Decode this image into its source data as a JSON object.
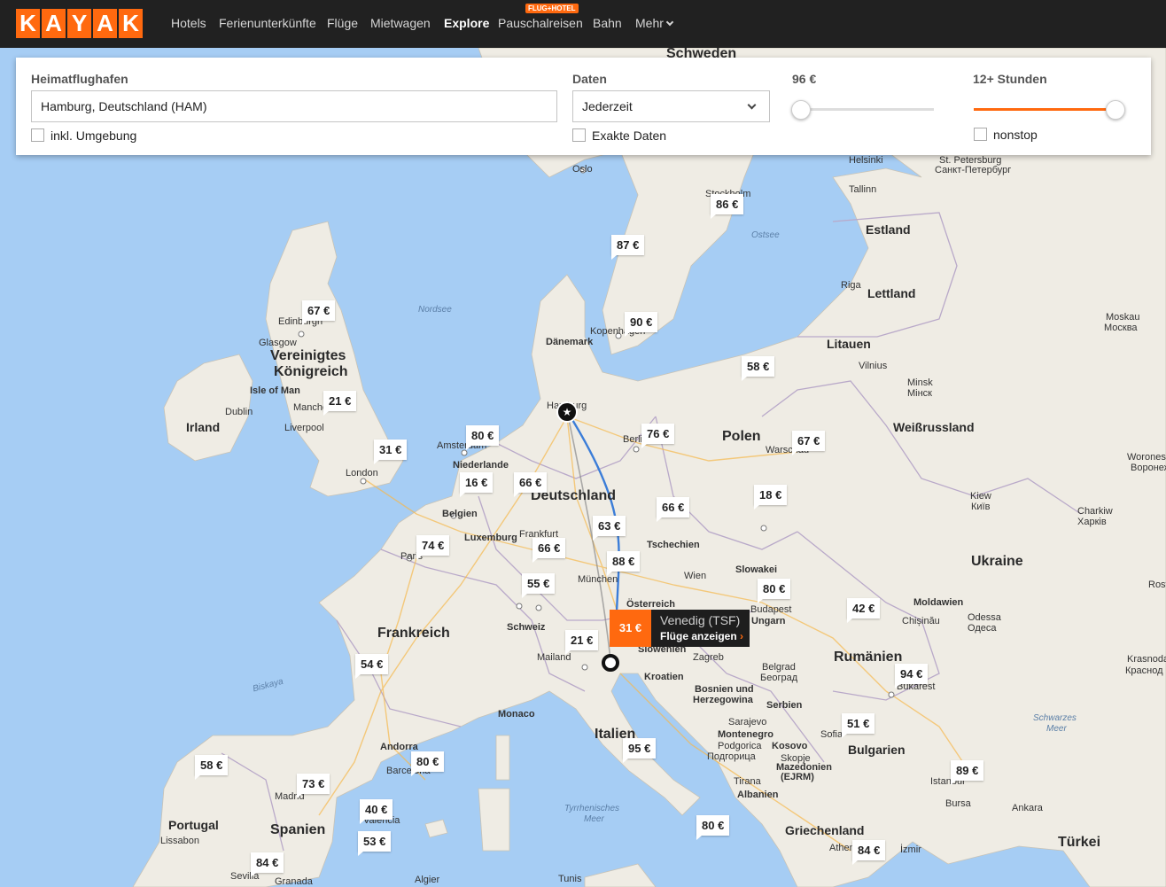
{
  "nav": {
    "logo_letters": [
      "K",
      "A",
      "Y",
      "A",
      "K"
    ],
    "items": [
      "Hotels",
      "Ferienunterkünfte",
      "Flüge",
      "Mietwagen",
      "Explore",
      "Pauschalreisen",
      "Bahn",
      "Mehr"
    ],
    "active": "Explore",
    "badge": "FLUG+HOTEL"
  },
  "search": {
    "home_label": "Heimatflughafen",
    "home_value": "Hamburg, Deutschland (HAM)",
    "nearby_label": "inkl. Umgebung",
    "dates_label": "Daten",
    "dates_value": "Jederzeit",
    "exact_dates_label": "Exakte Daten",
    "price_label": "96 €",
    "price_fraction": 0.0,
    "duration_label": "12+ Stunden",
    "duration_fraction": 1.0,
    "nonstop_label": "nonstop"
  },
  "popup": {
    "price": "31 €",
    "destination": "Venedig (TSF)",
    "link": "Flüge anzeigen",
    "link_arrow": "›"
  },
  "origin_marker_icon": "★",
  "prices": [
    "86 €",
    "87 €",
    "90 €",
    "67 €",
    "58 €",
    "21 €",
    "80 €",
    "76 €",
    "67 €",
    "31 €",
    "16 €",
    "66 €",
    "18 €",
    "63 €",
    "66 €",
    "74 €",
    "66 €",
    "88 €",
    "55 €",
    "80 €",
    "42 €",
    "21 €",
    "54 €",
    "94 €",
    "51 €",
    "58 €",
    "80 €",
    "95 €",
    "73 €",
    "89 €",
    "40 €",
    "53 €",
    "80 €",
    "84 €",
    "84 €"
  ],
  "map_labels": {
    "countries": [
      "Schweden",
      "Estland",
      "Lettland",
      "Litauen",
      "Vereinigtes",
      "Königreich",
      "Irland",
      "Polen",
      "Weißrussland",
      "Deutschland",
      "Niederlande",
      "Belgien",
      "Luxemburg",
      "Tschechien",
      "Slowakei",
      "Ukraine",
      "Österreich",
      "Ungarn",
      "Moldawien",
      "Rumänien",
      "Frankreich",
      "Schweiz",
      "Slowenien",
      "Kroatien",
      "Bosnien und",
      "Herzegowina",
      "Serbien",
      "Montenegro",
      "Kosovo",
      "Bulgarien",
      "Mazedonien",
      "(EJRM)",
      "Albanien",
      "Italien",
      "Griechenland",
      "Türkei",
      "Spanien",
      "Portugal",
      "Dänemark",
      "Isle of Man",
      "Andorra",
      "Monaco"
    ],
    "cities": [
      "Oslo",
      "Stockholm",
      "Helsinki",
      "St. Petersburg",
      "Санкт-Петербург",
      "Tallinn",
      "Riga",
      "Moskau",
      "Москва",
      "Vilnius",
      "Minsk",
      "Мінск",
      "Edinburgh",
      "Glasgow",
      "Dublin",
      "Manchester",
      "Liverpool",
      "London",
      "Amsterdam",
      "Hamburg",
      "Berlin",
      "Warschau",
      "Kiew",
      "Київ",
      "Kopenhagen",
      "Frankfurt",
      "München",
      "Wien",
      "Budapest",
      "Paris",
      "Mailand",
      "Zagreb",
      "Belgrad",
      "Београд",
      "Sarajevo",
      "Sofia",
      "Bukarest",
      "Chișinău",
      "Odessa",
      "Одеса",
      "Charkiw",
      "Харків",
      "Krasnodar",
      "Краснод",
      "Rostow am Don",
      "Podgorica",
      "Подгорица",
      "Skopje",
      "Tirana",
      "Athen",
      "Istanbul",
      "Bursa",
      "Ankara",
      "İzmir",
      "Barcelona",
      "Madrid",
      "Valencia",
      "Lissabon",
      "Sevilla",
      "Granada",
      "Algier",
      "Tunis",
      "Woronesch",
      "Воронеж"
    ],
    "seas": [
      "Nordsee",
      "Ostsee",
      "Biskaya",
      "Schwarzes",
      "Meer",
      "Tyrrhenisches",
      "Meer"
    ]
  },
  "colors": {
    "accent": "#ff690f",
    "nav_bg": "#212121",
    "water": "#a6cdf4",
    "land": "#f0ede5",
    "route_blue": "#3b7dd8",
    "route_gray": "#8a8a8a"
  }
}
